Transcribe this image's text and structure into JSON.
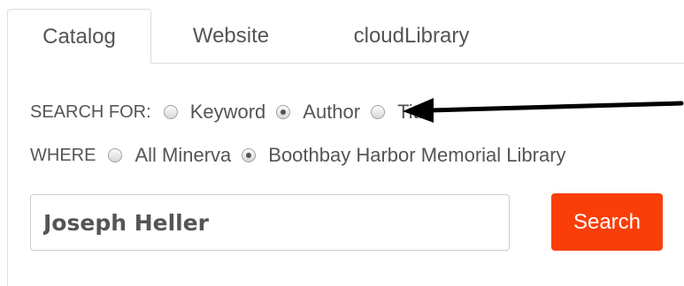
{
  "tabs": [
    {
      "label": "Catalog",
      "active": true
    },
    {
      "label": "Website",
      "active": false
    },
    {
      "label": "cloudLibrary",
      "active": false
    }
  ],
  "search_for": {
    "label": "SEARCH FOR:",
    "options": [
      {
        "label": "Keyword",
        "checked": false
      },
      {
        "label": "Author",
        "checked": true
      },
      {
        "label": "Title",
        "checked": false
      }
    ]
  },
  "where": {
    "label": "WHERE",
    "options": [
      {
        "label": "All Minerva",
        "checked": false
      },
      {
        "label": "Boothbay Harbor Memorial Library",
        "checked": true
      }
    ]
  },
  "search": {
    "value": "Joseph Heller",
    "button_label": "Search"
  },
  "colors": {
    "search_button": "#fa3e0a",
    "arrow": "#000000",
    "border": "#dddddd",
    "text": "#555555"
  }
}
